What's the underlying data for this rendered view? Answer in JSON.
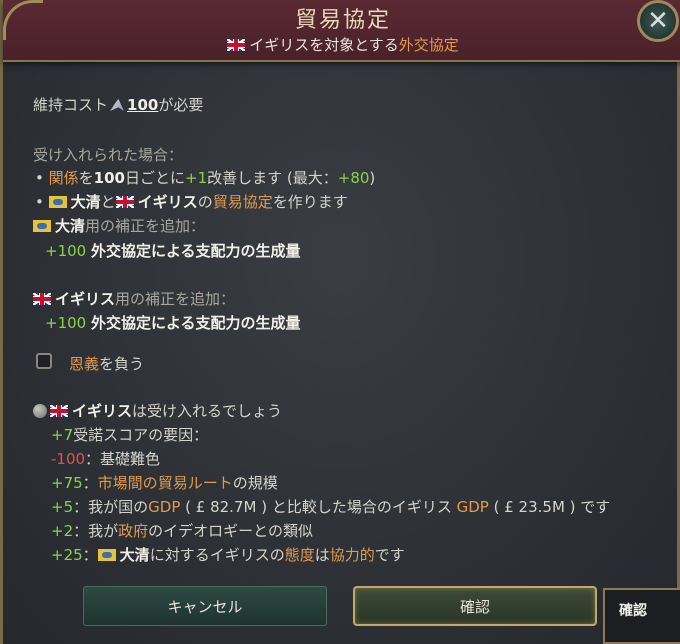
{
  "header": {
    "title": "貿易協定",
    "subtitle_country": "イギリス",
    "subtitle_mid": "を対象とする",
    "subtitle_action": "外交協定"
  },
  "cost": {
    "prefix": "維持コスト",
    "value": "100",
    "suffix": "が必要"
  },
  "accepted": {
    "heading": "受け入れられた場合：",
    "bullet1": {
      "p1": "•",
      "relation": "関係",
      "p2": "を",
      "amount": "100",
      "p3": "日ごとに",
      "delta": "+1",
      "p4": "改善します (最大：",
      "max": "+80",
      "p5": ")"
    },
    "bullet2": {
      "p1": "•",
      "country_a": "大清",
      "and": "と",
      "country_b": "イギリス",
      "of": "の",
      "pact": "貿易協定",
      "tail": "を作ります"
    },
    "qing_mod_country": "大清",
    "qing_mod_label": "用の補正を追加：",
    "qing_mod_value": "+100",
    "qing_mod_text": "外交協定による支配力の生成量",
    "uk_mod_country": "イギリス",
    "uk_mod_label": "用の補正を追加：",
    "uk_mod_value": "+100",
    "uk_mod_text": "外交協定による支配力の生成量"
  },
  "favor": {
    "label_highlight": "恩義",
    "label_rest": "を負う",
    "checked": false
  },
  "acceptance": {
    "country": "イギリス",
    "verdict": "は受け入れるでしょう",
    "score_value": "+7",
    "score_text": "受諾スコアの要因：",
    "factors": [
      {
        "value": "-100",
        "pre": "：基礎難色",
        "hl": "",
        "post": ""
      },
      {
        "value": "+75",
        "pre": "：",
        "hl": "市場間の",
        "hl2": "貿易ルート",
        "post": "の規模"
      },
      {
        "value": "+5",
        "pre": "：我が国の",
        "hl": "GDP",
        "mid": "( £ 82.7M ) と比較した場合のイギリス",
        "hl2": "GDP",
        "post": "( £ 23.5M ) です"
      },
      {
        "value": "+2",
        "pre": "：我が",
        "hl": "政府",
        "post": "のイデオロギーとの類似"
      },
      {
        "value": "+25",
        "pre": "：",
        "country": "大清",
        "mid": "に対するイギリスの",
        "hl": "態度",
        "mid2": "は",
        "hl2": "協力的",
        "post": "です"
      }
    ]
  },
  "buttons": {
    "cancel": "キャンセル",
    "confirm": "確認"
  },
  "tooltip": {
    "text": "確認"
  },
  "colors": {
    "header_bg": "#4a2129",
    "highlight_orange": "#e39a4e",
    "positive_green": "#8bd44a",
    "negative_red": "#e4524c",
    "gold_border": "#c3a86a"
  }
}
